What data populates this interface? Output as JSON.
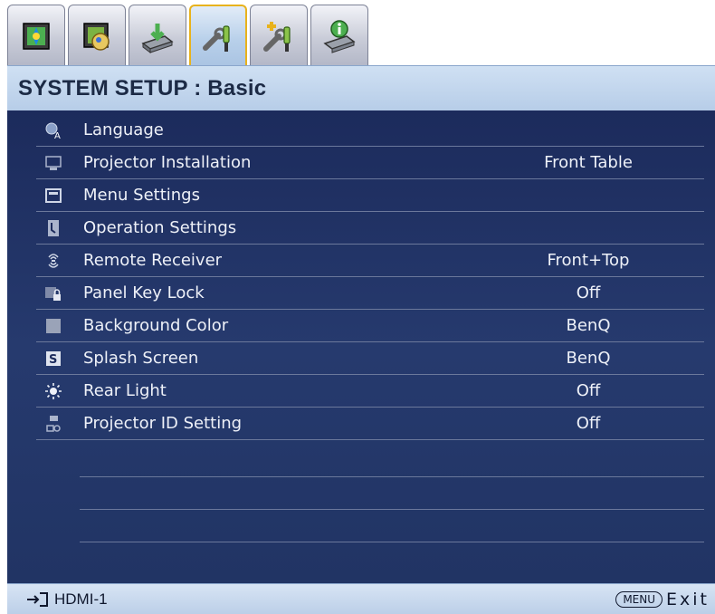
{
  "tabs": [
    {
      "icon": "picture-tab-icon",
      "active": false
    },
    {
      "icon": "picture-advanced-tab-icon",
      "active": false
    },
    {
      "icon": "display-tab-icon",
      "active": false
    },
    {
      "icon": "system-setup-basic-tab-icon",
      "active": true
    },
    {
      "icon": "system-setup-advanced-tab-icon",
      "active": false
    },
    {
      "icon": "information-tab-icon",
      "active": false
    }
  ],
  "header": {
    "title": "SYSTEM SETUP : Basic"
  },
  "menu": {
    "items": [
      {
        "icon": "language-icon",
        "label": "Language",
        "value": ""
      },
      {
        "icon": "projector-installation-icon",
        "label": "Projector Installation",
        "value": "Front Table"
      },
      {
        "icon": "menu-settings-icon",
        "label": "Menu Settings",
        "value": ""
      },
      {
        "icon": "operation-settings-icon",
        "label": "Operation Settings",
        "value": ""
      },
      {
        "icon": "remote-receiver-icon",
        "label": "Remote Receiver",
        "value": "Front+Top"
      },
      {
        "icon": "panel-key-lock-icon",
        "label": "Panel Key Lock",
        "value": "Off"
      },
      {
        "icon": "background-color-icon",
        "label": "Background Color",
        "value": "BenQ"
      },
      {
        "icon": "splash-screen-icon",
        "label": "Splash Screen",
        "value": "BenQ"
      },
      {
        "icon": "rear-light-icon",
        "label": "Rear Light",
        "value": "Off"
      },
      {
        "icon": "projector-id-icon",
        "label": "Projector ID Setting",
        "value": "Off"
      }
    ]
  },
  "footer": {
    "source_icon": "input-source-icon",
    "source": "HDMI-1",
    "menu_key": "MENU",
    "exit": "Exit"
  },
  "colors": {
    "panel": "#213464",
    "header": "#b7cde8",
    "active_tab_border": "#e8b21c",
    "text": "#eef1f8"
  }
}
